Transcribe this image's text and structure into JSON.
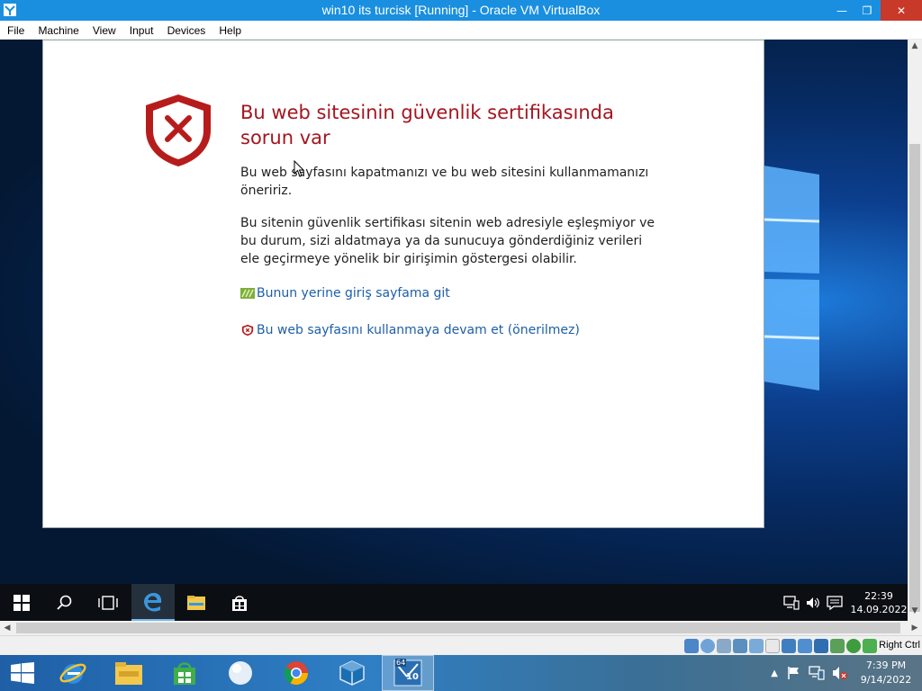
{
  "window": {
    "title": "win10 its turcisk [Running] - Oracle VM VirtualBox",
    "minimize_glyph": "—",
    "restore_glyph": "❐",
    "close_glyph": "✕"
  },
  "menubar": {
    "items": [
      "File",
      "Machine",
      "View",
      "Input",
      "Devices",
      "Help"
    ]
  },
  "certificate_warning": {
    "title": "Bu web sitesinin güvenlik sertifikasında sorun var",
    "paragraph1": "Bu web sayfasını kapatmanızı ve bu web sitesini kullanmamanızı öneririz.",
    "paragraph2": "Bu sitenin güvenlik sertifikası sitenin web adresiyle eşleşmiyor ve bu durum, sizi aldatmaya ya da sunucuya gönderdiğiniz verileri ele geçirmeye yönelik bir girişimin göstergesi olabilir.",
    "link_homepage": "Bunun yerine giriş sayfama git",
    "link_continue": "Bu web sayfasını kullanmaya devam et (önerilmez)",
    "colors": {
      "title": "#a5151e",
      "link": "#1e5fa8",
      "shield": "#b71c1c"
    }
  },
  "guest_taskbar": {
    "buttons": [
      "start-icon",
      "search-icon",
      "task-view-icon",
      "edge-icon",
      "file-explorer-icon",
      "store-icon"
    ],
    "tray_icons": [
      "network-icon",
      "volume-icon",
      "action-center-icon"
    ],
    "time": "22:39",
    "date": "14.09.2022"
  },
  "vb_status": {
    "icons": [
      "hard-disk-icon",
      "optical-drive-icon",
      "audio-icon",
      "network-icon",
      "usb-icon",
      "shared-folders-icon",
      "display-icon",
      "video-capture-icon",
      "recording-icon",
      "cpu-icon",
      "guest-additions-icon",
      "mouse-integration-icon"
    ],
    "host_key": "Right Ctrl"
  },
  "host_taskbar": {
    "buttons": [
      "start-icon",
      "internet-explorer-icon",
      "file-explorer-icon",
      "store-icon",
      "blank-orb-icon",
      "chrome-icon",
      "virtualbox-icon",
      "vm-win10-icon"
    ],
    "vm_badge": "10",
    "vm_bits": "64",
    "time": "7:39 PM",
    "date": "9/14/2022"
  }
}
